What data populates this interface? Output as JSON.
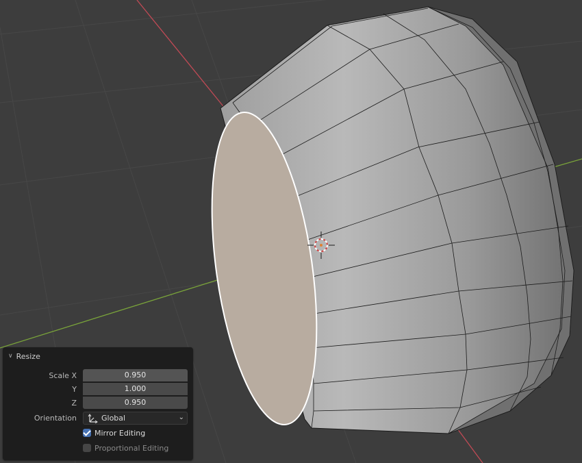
{
  "viewport": {
    "colors": {
      "background": "#3d3d3d",
      "grid": "#474747",
      "x_axis": "#c04a55",
      "y_axis": "#7aa43a",
      "mesh_light": "#b8b8b8",
      "mesh_dark": "#7c7c7c",
      "inner_face": "#b8aca0",
      "edge": "#1a1a1a",
      "selected_edge": "#ffffff",
      "cursor": "#d04040"
    },
    "icons": [
      "3d-cursor-icon"
    ]
  },
  "redo_panel": {
    "title": "Resize",
    "scale_x_label": "Scale X",
    "scale_x_value": "0.950",
    "y_label": "Y",
    "y_value": "1.000",
    "z_label": "Z",
    "z_value": "0.950",
    "orientation_label": "Orientation",
    "orientation_value": "Global",
    "mirror_label": "Mirror Editing",
    "mirror_checked": true,
    "proportional_label": "Proportional Editing",
    "proportional_checked": false
  }
}
